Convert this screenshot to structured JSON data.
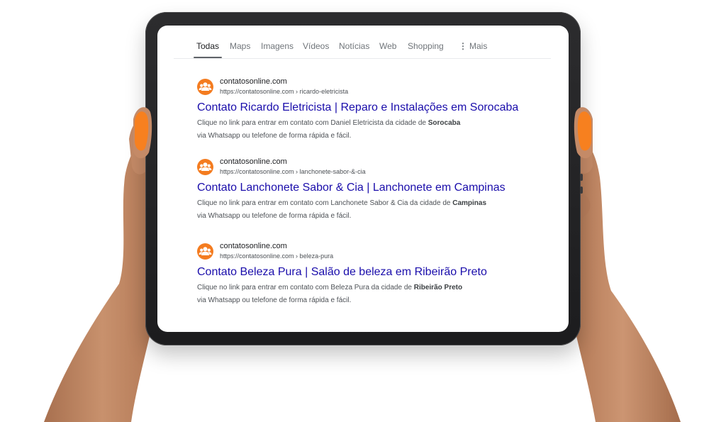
{
  "tabs": [
    {
      "label": "Todas",
      "active": true
    },
    {
      "label": "Maps"
    },
    {
      "label": "Imagens"
    },
    {
      "label": "Vídeos"
    },
    {
      "label": "Notícias"
    },
    {
      "label": "Web"
    },
    {
      "label": "Shopping"
    },
    {
      "label": "Mais",
      "icon": "kebab-menu-icon"
    }
  ],
  "results": [
    {
      "site": "contatosonline.com",
      "url": "https://contatosonline.com › ricardo-eletricista",
      "title": "Contato Ricardo Eletricista | Reparo e Instalações em Sorocaba",
      "snippet_pre": "Clique no link para entrar em contato com Daniel Eletricista da cidade de ",
      "snippet_city": "Sorocaba",
      "snippet_line2": "via Whatsapp ou telefone de forma rápida e fácil."
    },
    {
      "site": "contatosonline.com",
      "url": "https://contatosonline.com › lanchonete-sabor-&-cia",
      "title": "Contato Lanchonete Sabor & Cia | Lanchonete em Campinas",
      "snippet_pre": "Clique no link para entrar em contato com Lanchonete Sabor & Cia da cidade de ",
      "snippet_city": "Campinas",
      "snippet_line2": "via Whatsapp ou telefone de forma rápida e fácil."
    },
    {
      "site": "contatosonline.com",
      "url": "https://contatosonline.com › beleza-pura",
      "title": "Contato Beleza Pura | Salão de beleza em Ribeirão Preto",
      "snippet_pre": "Clique no link para entrar em contato com Beleza Pura da cidade de ",
      "snippet_city": "Ribeirão Preto",
      "snippet_line2": "via Whatsapp ou telefone de forma rápida e fácil."
    }
  ],
  "favicon_icon": "people-group-icon",
  "colors": {
    "favicon": "#f47c20",
    "link": "#1a0dab",
    "nail": "#f7801f",
    "skin": "#c48a67",
    "tablet_frame": "#1c1c1e"
  }
}
